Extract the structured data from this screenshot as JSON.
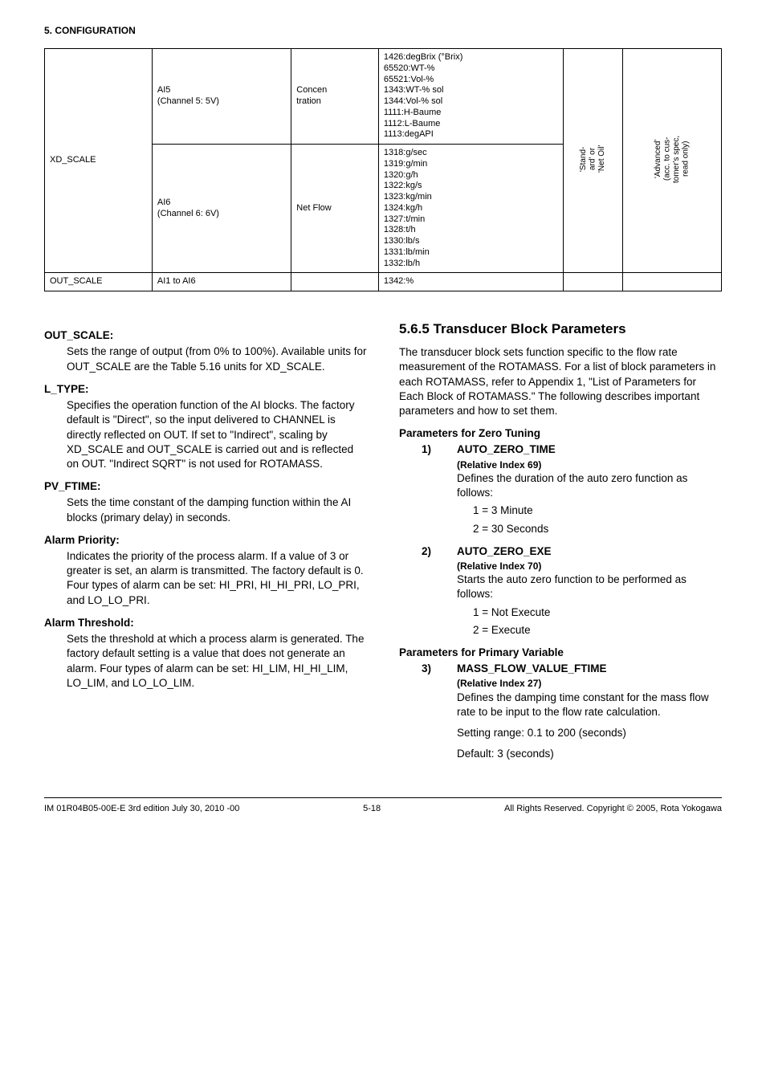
{
  "header": {
    "section": "5.  CONFIGURATION"
  },
  "table": {
    "rows": [
      {
        "param": "XD_SCALE",
        "chan": "AI5\n(Channel 5: 5V)",
        "type": "Concen\ntration",
        "codes": "1426:degBrix (°Brix)\n65520:WT-%\n65521:Vol-%\n1343:WT-% sol\n1344:Vol-% sol\n1111:H-Baume\n1112:L-Baume\n1113:degAPI",
        "v1": "'Stand-\nard' or\n'Net Oil'",
        "v2": "'Advanced'\n(acc. to cus-\ntomer's spec,\nread only)"
      },
      {
        "param": "",
        "chan": "AI6\n(Channel 6: 6V)",
        "type": "Net Flow",
        "codes": "1318:g/sec\n1319:g/min\n1320:g/h\n1322:kg/s\n1323:kg/min\n1324:kg/h\n1327:t/min\n1328:t/h\n1330:lb/s\n1331:lb/min\n1332:lb/h",
        "v1": "",
        "v2": ""
      },
      {
        "param": "OUT_SCALE",
        "chan": "AI1 to AI6",
        "type": "",
        "codes": "1342:%",
        "v1": "",
        "v2": ""
      }
    ]
  },
  "left": {
    "out_scale": {
      "label": "OUT_SCALE:",
      "text": "Sets the range of output (from 0% to 100%). Available units for OUT_SCALE are the Table 5.16 units for XD_SCALE."
    },
    "l_type": {
      "label": "L_TYPE:",
      "text": "Specifies the operation function of the AI blocks. The factory default is \"Direct\", so the input delivered to CHANNEL is directly reflected on OUT. If set to \"Indirect\", scaling by XD_SCALE and OUT_SCALE is carried out and is reflected on OUT. \"Indirect SQRT\" is not used for ROTAMASS."
    },
    "pv_ftime": {
      "label": "PV_FTIME:",
      "text": "Sets the time constant of the damping function within the AI blocks (primary delay) in seconds."
    },
    "alarm_prio": {
      "label": "Alarm Priority:",
      "text": "Indicates the priority of the process alarm. If a value of 3 or greater is set, an alarm is transmitted. The factory default is 0. Four types of alarm can be set: HI_PRI, HI_HI_PRI, LO_PRI, and LO_LO_PRI."
    },
    "alarm_thr": {
      "label": "Alarm Threshold:",
      "text": "Sets the threshold at which a process alarm is generated. The factory default setting is a value that does not generate an alarm. Four types of alarm can be set: HI_LIM, HI_HI_LIM, LO_LIM, and LO_LO_LIM."
    }
  },
  "right": {
    "heading": "5.6.5  Transducer Block Parameters",
    "intro": "The transducer block sets function specific to the flow rate measurement of the ROTAMASS.  For a list of block parameters in each ROTAMASS, refer to Appendix 1, \"List of Parameters for Each Block of ROTAMASS.\"   The following describes important parameters and how to set them.",
    "zero_title": "Parameters for Zero Tuning",
    "zero": {
      "p1": {
        "num": "1)",
        "title": "AUTO_ZERO_TIME",
        "sub": "(Relative Index 69)",
        "text": "Defines the duration of the auto zero function as follows:",
        "a": "1 = 3 Minute",
        "b": "2 = 30 Seconds"
      },
      "p2": {
        "num": "2)",
        "title": "AUTO_ZERO_EXE",
        "sub": "(Relative Index 70)",
        "text": "Starts the auto zero function to be performed as follows:",
        "a": "1 = Not Execute",
        "b": "2 = Execute"
      }
    },
    "prim_title": "Parameters for Primary Variable",
    "prim": {
      "p3": {
        "num": "3)",
        "title": "MASS_FLOW_VALUE_FTIME",
        "sub": "(Relative Index 27)",
        "text": "Defines the damping time constant for the mass flow rate to be input to the flow rate calculation.",
        "range": "Setting range: 0.1 to 200 (seconds)",
        "def": "Default:  3 (seconds)"
      }
    }
  },
  "footer": {
    "left": "IM 01R04B05-00E-E    3rd edition July 30, 2010 -00",
    "mid": "5-18",
    "right": "All Rights Reserved. Copyright © 2005, Rota Yokogawa"
  }
}
